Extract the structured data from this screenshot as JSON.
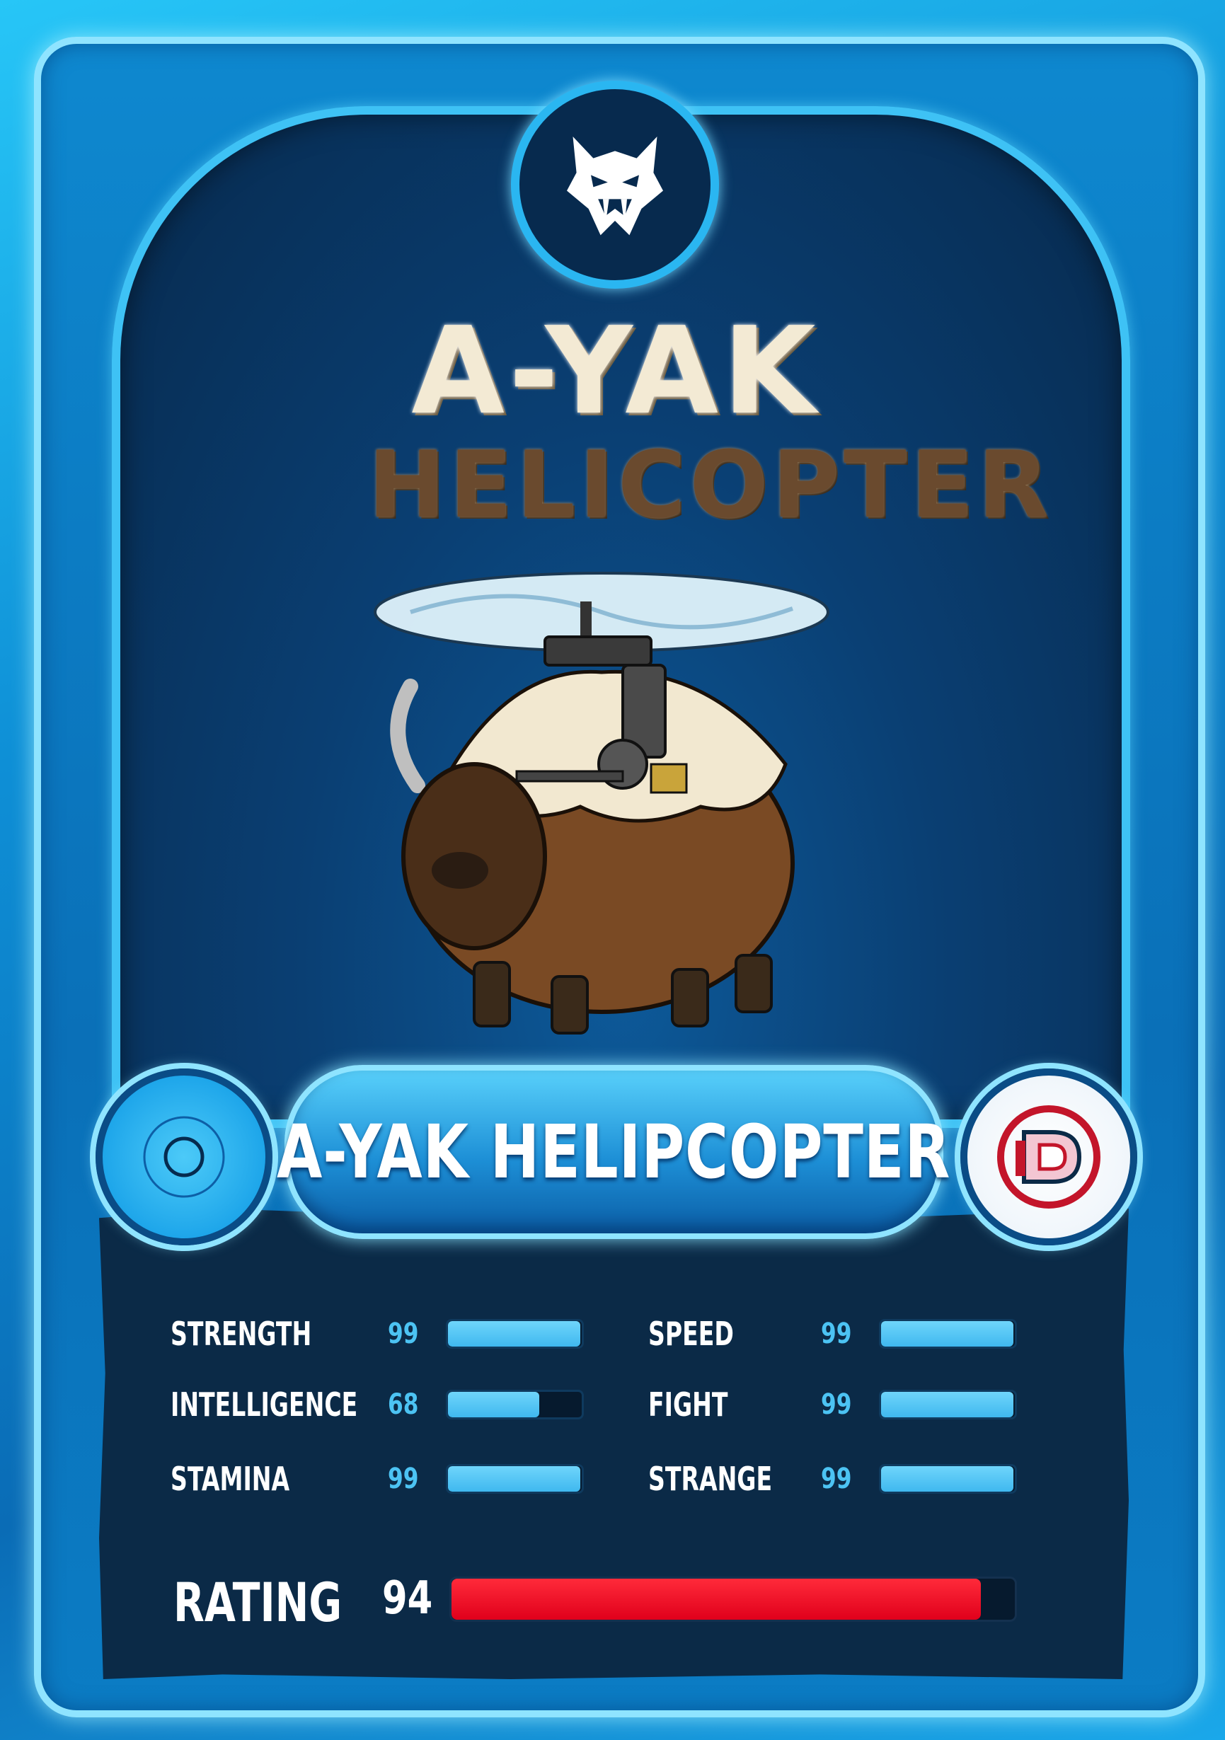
{
  "card": {
    "name": "A-YAK HELIPCOPTER",
    "title_art": {
      "line1": "A-YAK",
      "line2": "HELICOPTER"
    },
    "logo_icon": "sabertooth-tiger-head-icon",
    "left_badge_icon": "circle-target-icon",
    "right_badge_icon": "d-publisher-logo-icon",
    "colors": {
      "accent": "#2ab6f1",
      "panel": "#0b2a47",
      "bar": "#3fb8ef",
      "rating": "#e0001b"
    }
  },
  "stats": [
    {
      "label": "STRENGTH",
      "value": "99",
      "fraction": 0.99
    },
    {
      "label": "SPEED",
      "value": "99",
      "fraction": 0.99
    },
    {
      "label": "INTELLIGENCE",
      "value": "68",
      "fraction": 0.68
    },
    {
      "label": "FIGHT",
      "value": "99",
      "fraction": 0.99
    },
    {
      "label": "STAMINA",
      "value": "99",
      "fraction": 0.99
    },
    {
      "label": "STRANGE",
      "value": "99",
      "fraction": 0.99
    }
  ],
  "rating": {
    "label": "RATING",
    "value": "94",
    "fraction": 0.94
  }
}
